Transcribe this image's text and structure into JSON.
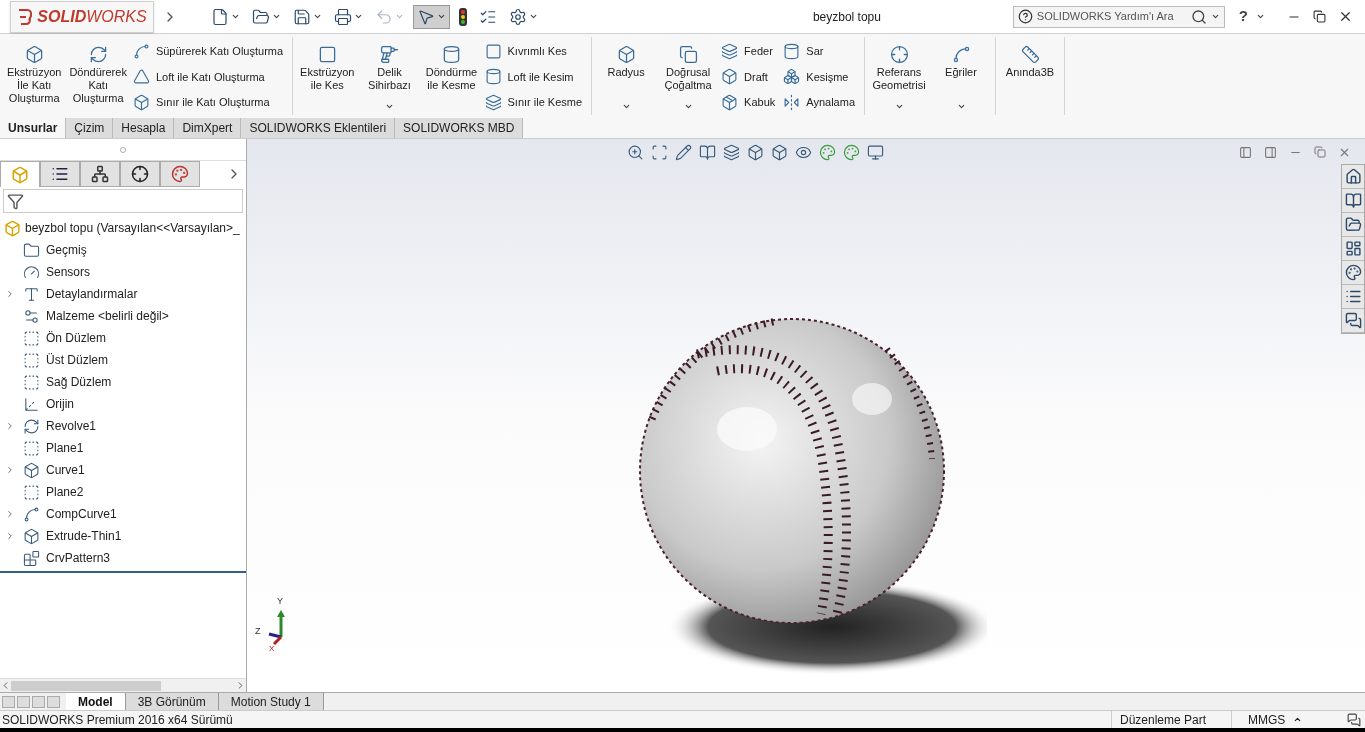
{
  "window": {
    "title": "beyzbol topu"
  },
  "logo": {
    "text": "**SOLID**WORKS"
  },
  "quick_access": [
    {
      "menu": true,
      "selected": false,
      "disabled": false
    },
    {
      "menu": true,
      "selected": false,
      "disabled": false
    },
    {
      "menu": true,
      "selected": false,
      "disabled": false
    },
    {
      "menu": true,
      "selected": false,
      "disabled": false
    },
    {
      "menu": true,
      "selected": false,
      "disabled": true
    },
    {
      "menu": true,
      "selected": true,
      "disabled": false
    },
    {
      "menu": false,
      "selected": false,
      "disabled": false
    },
    {
      "menu": false,
      "selected": false,
      "disabled": false
    },
    {
      "menu": true,
      "selected": false,
      "disabled": false
    }
  ],
  "search": {
    "placeholder": "SOLIDWORKS Yardım'ı Ara"
  },
  "help": {
    "label": "?"
  },
  "ribbon": [
    {
      "columns": [
        {
          "kind": "large",
          "label": "Ekstrüzyon\nİle Katı\nOluşturma",
          "menu": false
        },
        {
          "kind": "large",
          "label": "Döndürerek\nKatı\nOluşturma",
          "menu": false
        },
        {
          "kind": "stack",
          "items": [
            "Süpürerek Katı Oluşturma",
            "Loft ile Katı Oluşturma",
            "Sınır ile Katı Oluşturma"
          ]
        }
      ]
    },
    {
      "columns": [
        {
          "kind": "large",
          "label": "Ekstrüzyon\nile Kes",
          "menu": false
        },
        {
          "kind": "large",
          "label": "Delik\nSihirbazı",
          "menu": true
        },
        {
          "kind": "large",
          "label": "Döndürme\nile Kesme",
          "menu": false
        },
        {
          "kind": "stack",
          "items": [
            "Kıvrımlı Kes",
            "Loft ile Kesim",
            "Sınır ile Kesme"
          ]
        }
      ]
    },
    {
      "columns": [
        {
          "kind": "large",
          "label": "Radyus",
          "menu": true
        },
        {
          "kind": "large",
          "label": "Doğrusal\nÇoğaltma",
          "menu": true
        },
        {
          "kind": "stack",
          "items": [
            "Feder",
            "Draft",
            "Kabuk"
          ]
        },
        {
          "kind": "stack",
          "items": [
            "Sar",
            "Kesişme",
            "Aynalama"
          ]
        }
      ]
    },
    {
      "columns": [
        {
          "kind": "large",
          "label": "Referans\nGeometrisi",
          "menu": true
        },
        {
          "kind": "large",
          "label": "Eğriler",
          "menu": true
        }
      ]
    },
    {
      "columns": [
        {
          "kind": "large",
          "label": "Anında3B",
          "menu": false
        }
      ]
    }
  ],
  "command_tabs": [
    {
      "label": "Unsurlar",
      "selected": true
    },
    {
      "label": "Çizim",
      "selected": false
    },
    {
      "label": "Hesapla",
      "selected": false
    },
    {
      "label": "DimXpert",
      "selected": false
    },
    {
      "label": "SOLIDWORKS Eklentileri",
      "selected": false
    },
    {
      "label": "SOLIDWORKS MBD",
      "selected": false
    }
  ],
  "panel_tabs": [
    {
      "selected": true
    },
    {
      "selected": false
    },
    {
      "selected": false
    },
    {
      "selected": false
    },
    {
      "selected": false
    }
  ],
  "tree": {
    "label": "beyzbol topu  (Varsayılan<<Varsayılan>_",
    "children": [
      {
        "label": "Geçmiş",
        "expandable": false
      },
      {
        "label": "Sensors",
        "expandable": false
      },
      {
        "label": "Detaylandırmalar",
        "expandable": true
      },
      {
        "label": "Malzeme <belirli değil>",
        "expandable": false
      },
      {
        "label": "Ön Düzlem",
        "expandable": false
      },
      {
        "label": "Üst Düzlem",
        "expandable": false
      },
      {
        "label": "Sağ Düzlem",
        "expandable": false
      },
      {
        "label": "Orijin",
        "expandable": false
      },
      {
        "label": "Revolve1",
        "expandable": true
      },
      {
        "label": "Plane1",
        "expandable": false
      },
      {
        "label": "Curve1",
        "expandable": true
      },
      {
        "label": "Plane2",
        "expandable": false
      },
      {
        "label": "CompCurve1",
        "expandable": true
      },
      {
        "label": "Extrude-Thin1",
        "expandable": true
      },
      {
        "label": "CrvPattern3",
        "expandable": false
      }
    ]
  },
  "viewport": {
    "kind": "picture",
    "triad": [
      "Y",
      "Z",
      "X"
    ]
  },
  "bottom_tabs": [
    {
      "label": "Model",
      "selected": true
    },
    {
      "label": "3B Görünüm",
      "selected": false
    },
    {
      "label": "Motion Study 1",
      "selected": false
    }
  ],
  "status_bar": {
    "version": "SOLIDWORKS Premium 2016 x64 Sürümü",
    "mode": "Düzenleme Part",
    "units": "MMGS"
  }
}
